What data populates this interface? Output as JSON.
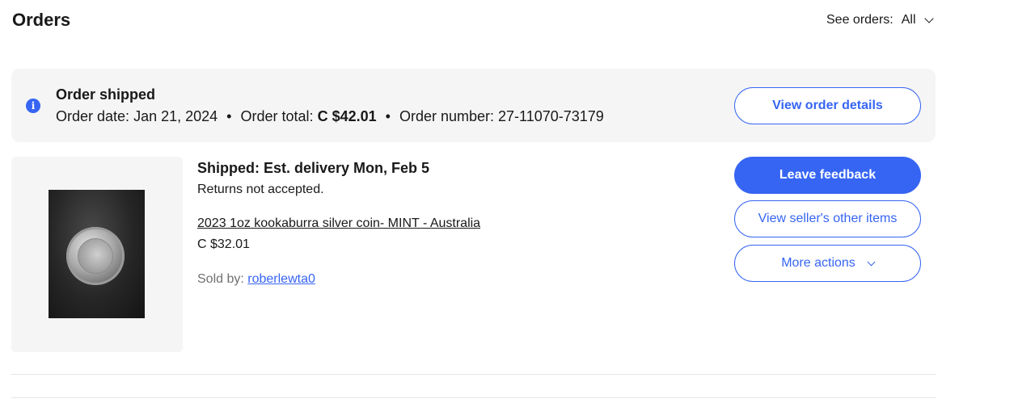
{
  "header": {
    "title": "Orders",
    "see_orders_label": "See orders:",
    "see_orders_value": "All"
  },
  "banner": {
    "icon": "info-icon",
    "title": "Order shipped",
    "order_date_label": "Order date:",
    "order_date": "Jan 21, 2024",
    "order_total_label": "Order total:",
    "order_total": "C $42.01",
    "order_number_label": "Order number:",
    "order_number": "27-11070-73179",
    "separator": "•",
    "view_details_label": "View order details"
  },
  "item": {
    "image_icon": "coin-photo",
    "status": "Shipped: Est. delivery Mon, Feb 5",
    "returns": "Returns not accepted.",
    "title": "2023 1oz kookaburra silver coin- MINT - Australia",
    "price": "C $32.01",
    "sold_by_label": "Sold by:",
    "seller": "roberlewta0"
  },
  "actions": {
    "leave_feedback": "Leave feedback",
    "view_seller_items": "View seller's other items",
    "more_actions": "More actions"
  },
  "colors": {
    "accent": "#3665f3",
    "banner_bg": "#f5f5f5",
    "text": "#191919",
    "muted": "#707070"
  }
}
